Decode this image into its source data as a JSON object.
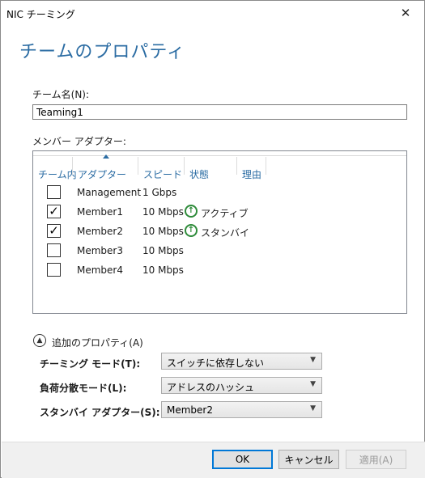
{
  "window": {
    "title": "NIC チーミング",
    "close_glyph": "✕"
  },
  "heading": "チームのプロパティ",
  "team_name": {
    "label": "チーム名(N):",
    "value": "Teaming1"
  },
  "members": {
    "label": "メンバー アダプター:",
    "columns": [
      "チーム内",
      "アダプター",
      "スピード",
      "状態",
      "理由"
    ],
    "rows": [
      {
        "checked": false,
        "adapter": "Management",
        "speed": "1 Gbps",
        "status": ""
      },
      {
        "checked": true,
        "adapter": "Member1",
        "speed": "10 Mbps",
        "status": "アクティブ"
      },
      {
        "checked": true,
        "adapter": "Member2",
        "speed": "10 Mbps",
        "status": "スタンバイ"
      },
      {
        "checked": false,
        "adapter": "Member3",
        "speed": "10 Mbps",
        "status": ""
      },
      {
        "checked": false,
        "adapter": "Member4",
        "speed": "10 Mbps",
        "status": ""
      }
    ],
    "check_glyph": "✓",
    "status_icon": "arrow-up-circle-icon",
    "status_color": "#2e8b3a"
  },
  "additional": {
    "label": "追加のプロパティ(A)",
    "teaming_mode": {
      "label": "チーミング モード(T):",
      "value": "スイッチに依存しない"
    },
    "load_balancing": {
      "label": "負荷分散モード(L):",
      "value": "アドレスのハッシュ"
    },
    "standby_adapter": {
      "label": "スタンバイ アダプター(S):",
      "value": "Member2"
    }
  },
  "buttons": {
    "ok": "OK",
    "cancel": "キャンセル",
    "apply": "適用(A)"
  },
  "colors": {
    "accent": "#2b6ca3",
    "focus": "#0078d7"
  }
}
